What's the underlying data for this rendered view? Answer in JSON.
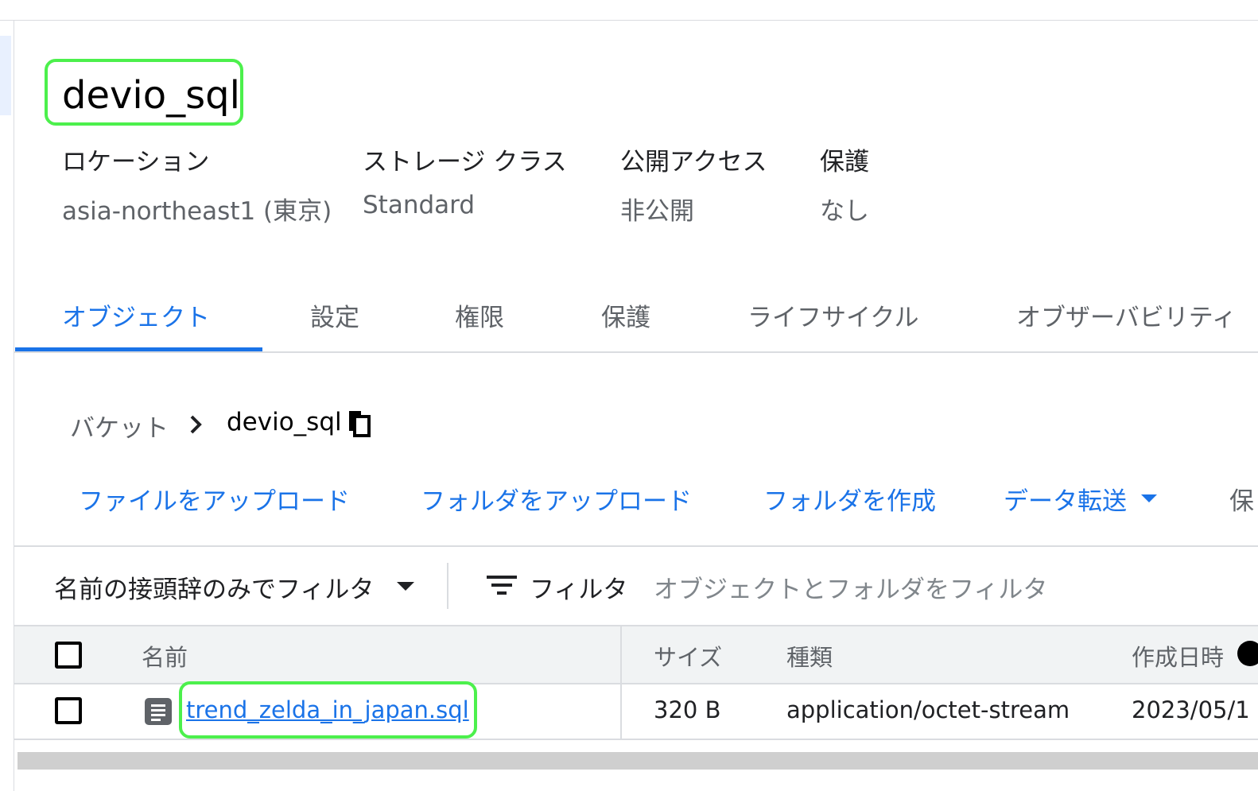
{
  "bucket": {
    "title": "devio_sql"
  },
  "meta": [
    {
      "label": "ロケーション",
      "value": "asia-northeast1 (東京)"
    },
    {
      "label": "ストレージ クラス",
      "value": "Standard"
    },
    {
      "label": "公開アクセス",
      "value": "非公開"
    },
    {
      "label": "保護",
      "value": "なし"
    }
  ],
  "tabs": [
    "オブジェクト",
    "設定",
    "権限",
    "保護",
    "ライフサイクル",
    "オブザーバビリティ"
  ],
  "breadcrumb": {
    "root": "バケット",
    "current": "devio_sql"
  },
  "actions": [
    "ファイルをアップロード",
    "フォルダをアップロード",
    "フォルダを作成",
    "データ転送",
    "保"
  ],
  "filter": {
    "prefix_label": "名前の接頭辞のみでフィルタ",
    "filter_label": "フィルタ",
    "placeholder": "オブジェクトとフォルダをフィルタ"
  },
  "table": {
    "headers": {
      "name": "名前",
      "size": "サイズ",
      "type": "種類",
      "created": "作成日時"
    },
    "rows": [
      {
        "name": "trend_zelda_in_japan.sql",
        "size": "320 B",
        "type": "application/octet-stream",
        "created": "2023/05/1"
      }
    ]
  },
  "colors": {
    "accent": "#1a73e8",
    "highlight": "#4cf04c"
  },
  "icons": {
    "copy": "copy-icon",
    "chevron": "chevron-right-icon",
    "filter": "filter-lines-icon",
    "dropdown": "caret-down-icon",
    "file": "file-doc-icon",
    "help": "help-icon"
  }
}
